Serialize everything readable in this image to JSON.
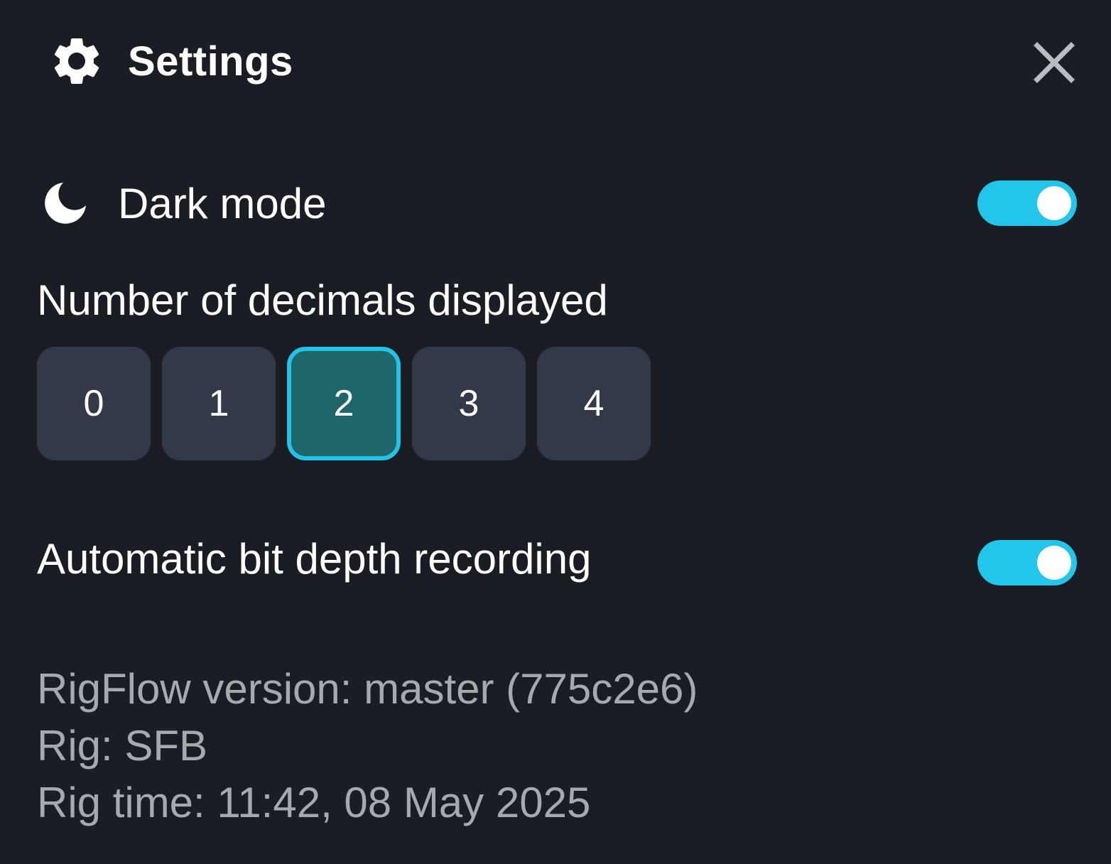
{
  "header": {
    "title": "Settings",
    "icon": "gear-icon",
    "close_icon": "close-icon"
  },
  "dark_mode": {
    "label": "Dark mode",
    "icon": "moon-icon",
    "enabled": true
  },
  "decimals": {
    "title": "Number of decimals displayed",
    "options": [
      "0",
      "1",
      "2",
      "3",
      "4"
    ],
    "selected": "2"
  },
  "bit_depth": {
    "label": "Automatic bit depth recording",
    "enabled": true
  },
  "info": {
    "version": "RigFlow version: master (775c2e6)",
    "rig": "Rig: SFB",
    "rig_time": "Rig time: 11:42, 08 May 2025"
  },
  "colors": {
    "background": "#1a1d24",
    "accent": "#22c6ea",
    "selected_bg": "#1f666b",
    "button_bg": "#333947",
    "muted_text": "#a6a9ae"
  }
}
